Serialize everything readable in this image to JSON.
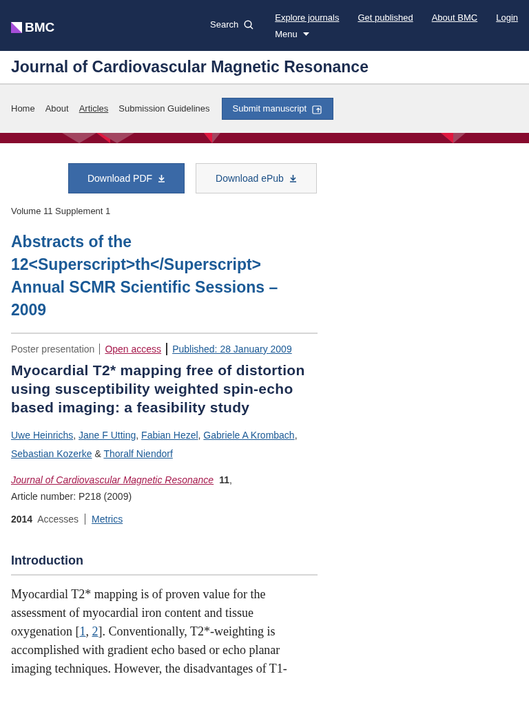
{
  "header": {
    "logo": "BMC",
    "search": "Search",
    "links": [
      "Explore journals",
      "Get published",
      "About BMC",
      "Login"
    ],
    "menu": "Menu"
  },
  "journal_title": "Journal of Cardiovascular Magnetic Resonance",
  "nav": {
    "items": [
      {
        "label": "Home",
        "selected": false
      },
      {
        "label": "About",
        "selected": false
      },
      {
        "label": "Articles",
        "selected": true
      },
      {
        "label": "Submission Guidelines",
        "selected": false
      }
    ],
    "submit": "Submit manuscript"
  },
  "downloads": [
    {
      "label": "Download PDF",
      "kind": "primary"
    },
    {
      "label": "Download ePub",
      "kind": "secondary"
    }
  ],
  "volume": "Volume 11 Supplement 1",
  "supplement_title": "Abstracts of the 12<Superscript>th</Superscript> Annual SCMR Scientific Sessions – 2009",
  "meta": {
    "type": "Poster presentation",
    "access": "Open access",
    "published": "Published: 28 January 2009"
  },
  "article_title": "Myocardial T2* mapping free of distortion using susceptibility weighted spin-echo based imaging: a feasibility study",
  "authors": [
    {
      "name": "Uwe Heinrichs",
      "separator": ","
    },
    {
      "name": "Jane F Utting",
      "separator": ","
    },
    {
      "name": "Fabian Hezel",
      "separator": ","
    },
    {
      "name": "Gabriele A Krombach",
      "separator": ","
    },
    {
      "name": "Sebastian Kozerke",
      "separator": "&"
    },
    {
      "name": "Thoralf Niendorf"
    }
  ],
  "citation": {
    "journal": "Journal of Cardiovascular Magnetic Resonance",
    "volume": "11",
    "punctuation": ",",
    "rest": "Article number: P218 (2009)"
  },
  "metrics": {
    "count": "2014",
    "label": "Accesses",
    "link": "Metrics"
  },
  "section": {
    "heading": "Introduction",
    "parts": [
      "Myocardial T2* mapping is of proven value for the assessment of myocardial iron content and tissue oxygenation [",
      "1",
      ", ",
      "2",
      "]. Conventionally, T2*-weighting is accomplished with gradient echo based or echo planar imaging techniques. However, the disadvantages of T1-"
    ]
  }
}
